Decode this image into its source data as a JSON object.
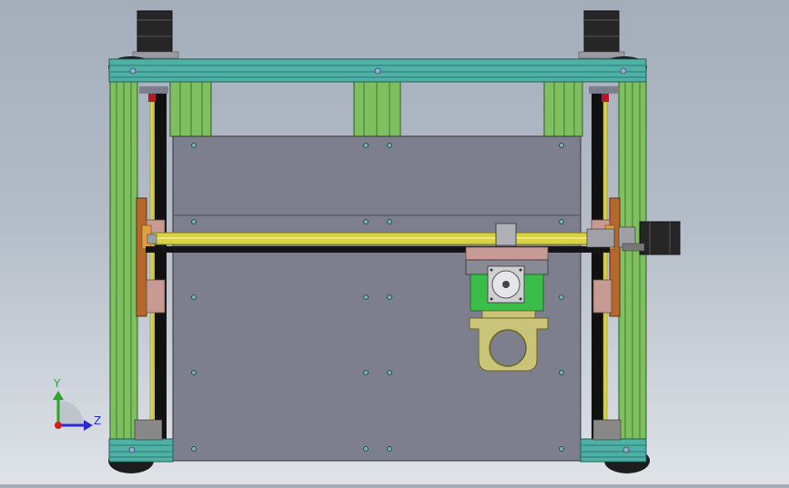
{
  "triad": {
    "y_label": "Y",
    "z_label": "Z"
  },
  "colors": {
    "background_top": "#a4aebb",
    "background_bottom": "#dfe3e8",
    "frame_green": "#7fbf5f",
    "frame_teal": "#4fb0a6",
    "plate_gray": "#7e7f8e",
    "rod_yellow": "#d8d244",
    "motor_black": "#262626",
    "bracket_copper": "#b5672c",
    "bracket_pink": "#c89a94",
    "mount_tan": "#c9c47a",
    "hotend_green": "#3bbd4a",
    "axis_y": "#2aa62a",
    "axis_z": "#2b2bd6",
    "axis_x": "#d22020"
  }
}
